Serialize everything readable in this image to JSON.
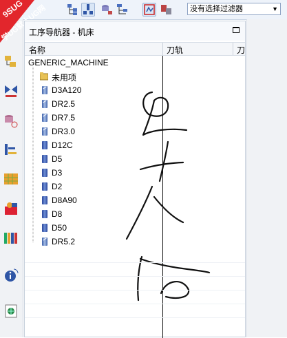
{
  "badge": {
    "top_text": "9SUG",
    "bottom_text": "学UG就上UG网"
  },
  "toolbar": {
    "filter_value": "没有选择过滤器",
    "buttons": [
      "program-order-view-icon",
      "machine-tool-view-icon",
      "geometry-view-icon",
      "machining-method-view-icon",
      "manufacturing-op-icon",
      "tool-path-icon"
    ]
  },
  "rail": {
    "icons": [
      "operation-navigator-icon",
      "machine-tool-navigator-icon",
      "part-navigator-icon",
      "assembly-navigator-icon",
      "reuse-library-icon",
      "roles-icon",
      "history-icon",
      "library-icon",
      "info-icon",
      "web-browser-icon"
    ]
  },
  "panel": {
    "title": "工序导航器 - 机床",
    "columns": {
      "name": "名称",
      "toolpath": "刀轨",
      "extra": "刀"
    },
    "root": "GENERIC_MACHINE",
    "unused": "未用项",
    "tools": [
      {
        "label": "D3A120",
        "type": "ball"
      },
      {
        "label": "DR2.5",
        "type": "ball"
      },
      {
        "label": "DR7.5",
        "type": "ball"
      },
      {
        "label": "DR3.0",
        "type": "ball"
      },
      {
        "label": "D12C",
        "type": "flat"
      },
      {
        "label": "D5",
        "type": "flat"
      },
      {
        "label": "D3",
        "type": "flat"
      },
      {
        "label": "D2",
        "type": "flat"
      },
      {
        "label": "D8A90",
        "type": "flat"
      },
      {
        "label": "D8",
        "type": "flat"
      },
      {
        "label": "D50",
        "type": "flat"
      },
      {
        "label": "DR5.2",
        "type": "ball"
      }
    ]
  },
  "colors": {
    "badge_red": "#e2262c",
    "accent_blue": "#2f56a6",
    "panel_border": "#c7d0dc"
  }
}
